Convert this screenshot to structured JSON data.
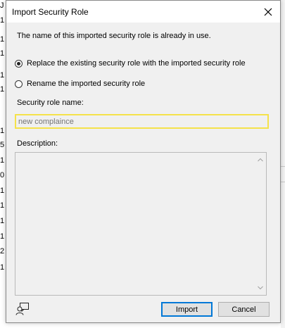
{
  "background": {
    "left_chars": [
      "J",
      "1",
      "1",
      "1",
      "1",
      "1",
      "1",
      "5",
      "1",
      "0",
      "1",
      "1",
      "1",
      "1",
      "2",
      "1"
    ]
  },
  "dialog": {
    "title": "Import Security Role",
    "message": "The name of this imported security role is already in use.",
    "options": [
      {
        "label": "Replace the existing security role with the imported security role",
        "checked": true
      },
      {
        "label": "Rename the imported security role",
        "checked": false
      }
    ],
    "name_label": "Security role name:",
    "name_placeholder": "new complaince",
    "description_label": "Description:",
    "description_value": "",
    "import_label": "Import",
    "cancel_label": "Cancel"
  },
  "colors": {
    "dialog_bg": "#f0f0f0",
    "input_focus_border": "#f5e24a",
    "default_button_border": "#0078d7"
  }
}
